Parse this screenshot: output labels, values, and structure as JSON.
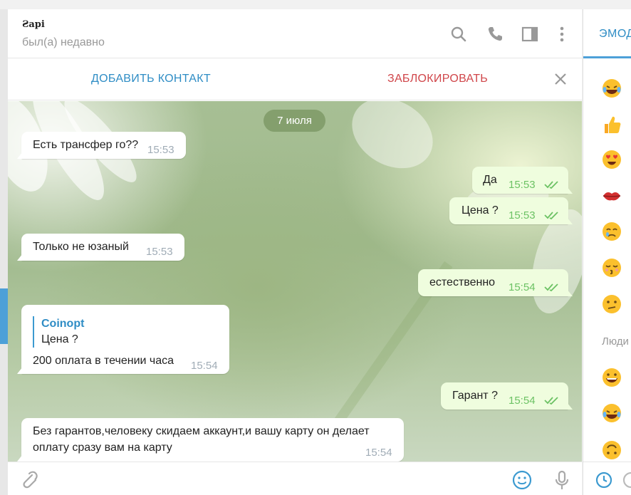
{
  "header": {
    "title": "Ƨapi",
    "status": "был(а) недавно"
  },
  "actionbar": {
    "add_contact": "ДОБАВИТЬ КОНТАКТ",
    "block": "ЗАБЛОКИРОВАТЬ"
  },
  "date_label": "7 июля",
  "messages": [
    {
      "dir": "in",
      "text": "Есть трансфер го??",
      "time": "15:53"
    },
    {
      "dir": "out",
      "text": "Да",
      "time": "15:53"
    },
    {
      "dir": "out",
      "text": "Цена ?",
      "time": "15:53"
    },
    {
      "dir": "in",
      "text": "Только не юзаный",
      "time": "15:53"
    },
    {
      "dir": "out",
      "text": "естественно",
      "time": "15:54"
    },
    {
      "dir": "in",
      "reply_name": "Coinopt",
      "reply_text": "Цена ?",
      "text": "200 оплата в течении часа",
      "time": "15:54"
    },
    {
      "dir": "out",
      "text": "Гарант ?",
      "time": "15:54"
    },
    {
      "dir": "in",
      "text_line1": "Без гарантов,человеку скидаем аккаунт,и вашу карту он делает",
      "text_line2": "оплату сразу вам на карту",
      "time": "15:54"
    }
  ],
  "emoji_panel": {
    "tab_label": "ЭМОД",
    "section_label": "Люди",
    "emojis": [
      "laughing-tears",
      "thumbs-up",
      "heart-eyes",
      "kiss-lips",
      "crying",
      "kissing-closed-eyes",
      "confused",
      "grinning",
      "laughing-tears",
      "upside-down"
    ]
  },
  "colors": {
    "accent": "#2f8dc5",
    "danger": "#d0464a",
    "out_bubble": "#effdde",
    "read_check": "#6cc264"
  }
}
